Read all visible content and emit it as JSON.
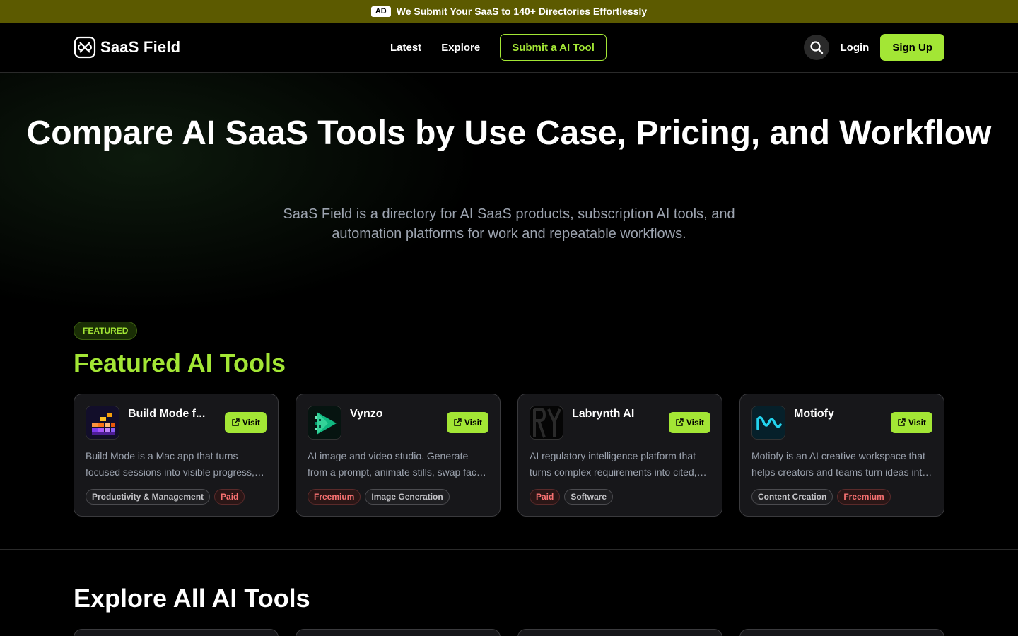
{
  "ad": {
    "badge": "AD",
    "text": "We Submit Your SaaS to 140+ Directories Effortlessly"
  },
  "nav": {
    "brand": "SaaS Field",
    "links": [
      "Latest",
      "Explore"
    ],
    "submit": "Submit a AI Tool",
    "login": "Login",
    "signup": "Sign Up"
  },
  "hero": {
    "title": "Compare AI SaaS Tools by Use Case, Pricing, and Workflow",
    "subtitle": "SaaS Field is a directory for AI SaaS products, subscription AI tools, and automation platforms for work and repeatable workflows."
  },
  "featured": {
    "badge": "FEATURED",
    "title": "Featured AI Tools",
    "visit_label": "Visit",
    "cards": [
      {
        "name": "Build Mode f...",
        "icon": "build-mode-logo",
        "desc": "Build Mode is a Mac app that turns focused sessions into visible progress, building a little world as you work.",
        "tags": [
          "Productivity & Management",
          "Paid"
        ]
      },
      {
        "name": "Vynzo",
        "icon": "vynzo-logo",
        "desc": "AI image and video studio. Generate from a prompt, animate stills, swap faces and more in one place.",
        "tags": [
          "Freemium",
          "Image Generation"
        ]
      },
      {
        "name": "Labrynth AI",
        "icon": "labrynth-logo",
        "desc": "AI regulatory intelligence platform that turns complex requirements into cited, actionable answers.",
        "tags": [
          "Paid",
          "Software"
        ]
      },
      {
        "name": "Motiofy",
        "icon": "motiofy-logo",
        "desc": "Motiofy is an AI creative workspace that helps creators and teams turn ideas into motion content.",
        "tags": [
          "Content Creation",
          "Freemium"
        ]
      }
    ]
  },
  "explore": {
    "title": "Explore All AI Tools"
  },
  "colors": {
    "accent": "#a3e635",
    "ad_bar": "#5c5a00",
    "pricing_tag": "#f87171"
  }
}
